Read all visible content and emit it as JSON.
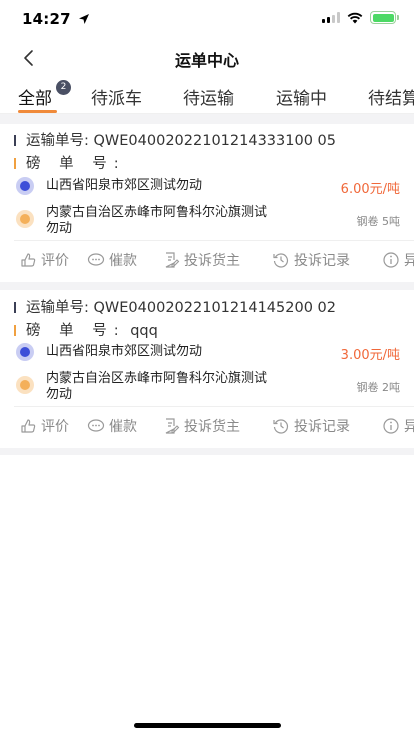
{
  "status_bar": {
    "time": "14:27"
  },
  "nav": {
    "title": "运单中心"
  },
  "tabs": [
    {
      "label": "全部",
      "badge": "2",
      "active": true
    },
    {
      "label": "待派车"
    },
    {
      "label": "待运输"
    },
    {
      "label": "运输中"
    },
    {
      "label": "待结算"
    }
  ],
  "labels": {
    "waybill_no": "运输单号:",
    "pound_no": "磅 单 号:"
  },
  "orders": [
    {
      "waybill_no": "QWE04002022101214333100 05",
      "pound_no": "",
      "origin": "山西省阳泉市郊区测试勿动",
      "destination_line1": "内蒙古自治区赤峰市阿鲁科尔沁旗测试",
      "destination_line2": "勿动",
      "price": "6.00元/吨",
      "cargo": "钢卷 5吨"
    },
    {
      "waybill_no": "QWE04002022101214145200 02",
      "pound_no": "qqq",
      "origin": "山西省阳泉市郊区测试勿动",
      "destination_line1": "内蒙古自治区赤峰市阿鲁科尔沁旗测试",
      "destination_line2": "勿动",
      "price": "3.00元/吨",
      "cargo": "钢卷 2吨"
    }
  ],
  "actions": {
    "rate": "评价",
    "urge": "催款",
    "complain": "投诉货主",
    "records": "投诉记录",
    "abnormal": "异"
  },
  "colors": {
    "accent": "#f08a3a",
    "price": "#f0683a",
    "origin_dot": "#3d4fd8",
    "destination_dot": "#f4b05a"
  }
}
